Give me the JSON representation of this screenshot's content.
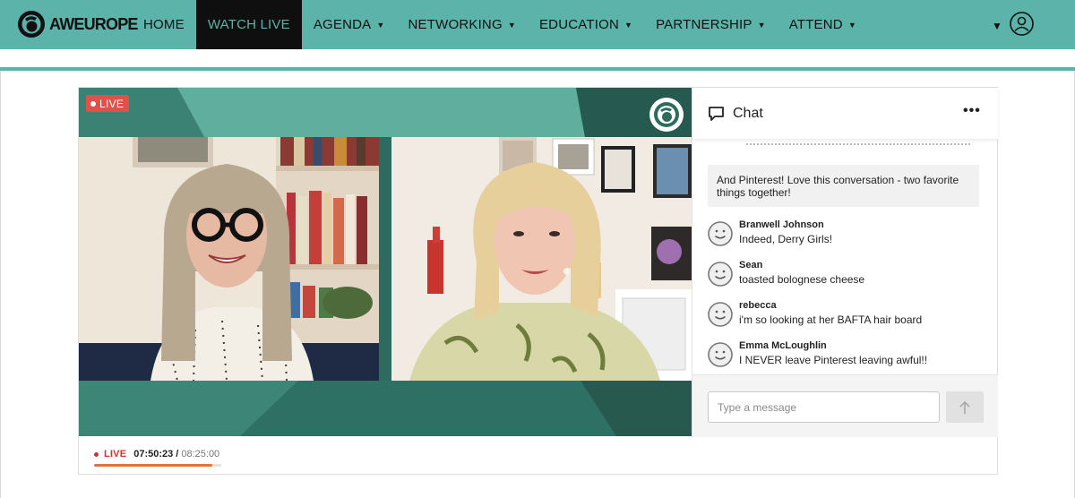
{
  "brand": {
    "name": "AWEUROPE",
    "accent": "#5bb3a9",
    "dark": "#0f0f0f"
  },
  "nav": {
    "items": [
      {
        "label": "HOME",
        "dropdown": false,
        "active": false
      },
      {
        "label": "WATCH LIVE",
        "dropdown": false,
        "active": true
      },
      {
        "label": "AGENDA",
        "dropdown": true,
        "active": false
      },
      {
        "label": "NETWORKING",
        "dropdown": true,
        "active": false
      },
      {
        "label": "EDUCATION",
        "dropdown": true,
        "active": false
      },
      {
        "label": "PARTNERSHIP",
        "dropdown": true,
        "active": false
      },
      {
        "label": "ATTEND",
        "dropdown": true,
        "active": false
      }
    ],
    "icons": {
      "chevron": "chevron-down-icon",
      "user": "user-circle-icon"
    }
  },
  "video": {
    "live_label": "LIVE",
    "live_color": "#e05149",
    "icons": {
      "logo": "aweurope-logo-icon"
    }
  },
  "chat": {
    "title": "Chat",
    "more_label": "•••",
    "pinned_message": "And Pinterest! Love this conversation - two favorite things together!",
    "messages": [
      {
        "name": "Branwell Johnson",
        "text": "Indeed, Derry Girls!"
      },
      {
        "name": "Sean",
        "text": "toasted bolognese cheese"
      },
      {
        "name": "rebecca",
        "text": "i'm so looking at her BAFTA hair board"
      },
      {
        "name": "Emma McLoughlin",
        "text": "I NEVER leave Pinterest leaving awful!!"
      }
    ],
    "input_placeholder": "Type a message",
    "icons": {
      "chat": "speech-bubble-icon",
      "send": "arrow-up-icon",
      "avatar": "smiley-avatar-icon"
    }
  },
  "player_controls": {
    "live_label": "LIVE",
    "current_time": "07:50:23",
    "separator": "/",
    "duration": "08:25:00",
    "progress": 0.9314,
    "progress_color": "#e0743a"
  }
}
